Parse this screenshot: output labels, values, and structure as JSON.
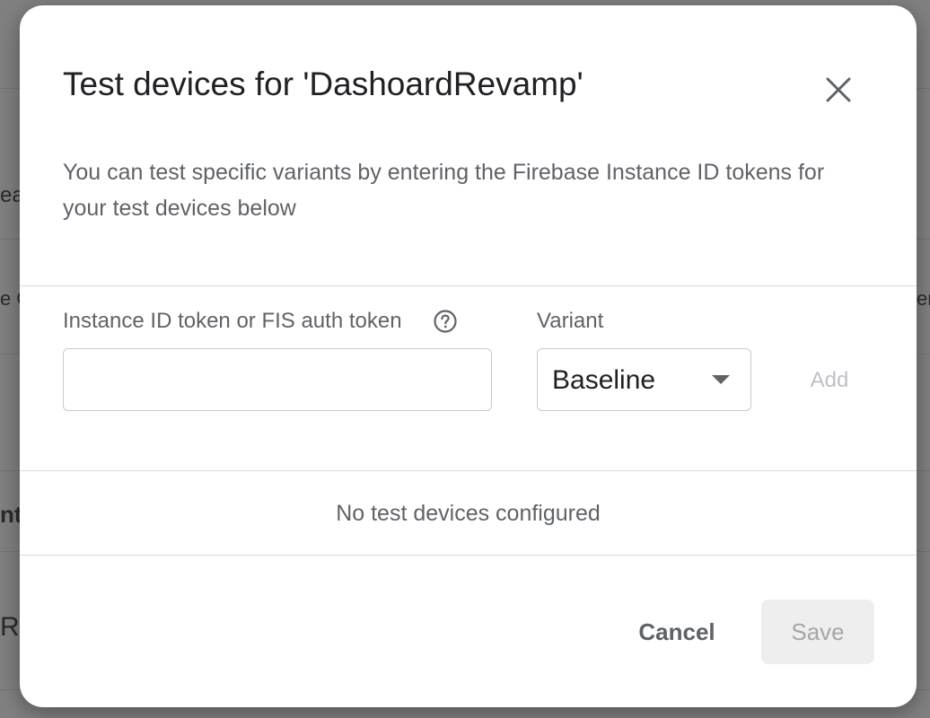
{
  "background": {
    "fragments": [
      "ea",
      "e O",
      "nti",
      "Ra",
      "er"
    ]
  },
  "dialog": {
    "title": "Test devices for 'DashoardRevamp'",
    "close_icon": "close-icon",
    "description": "You can test specific variants by entering the Firebase Instance ID tokens for your test devices below",
    "token_field": {
      "label": "Instance ID token or FIS auth token",
      "value": "",
      "help_icon": "help-circle-icon"
    },
    "variant_field": {
      "label": "Variant",
      "selected": "Baseline"
    },
    "add_label": "Add",
    "empty_state": "No test devices configured",
    "cancel_label": "Cancel",
    "save_label": "Save"
  },
  "colors": {
    "title": "#202124",
    "secondary_text": "#5f6368",
    "disabled_text": "#bdc1c6",
    "divider": "#dadce0",
    "save_disabled_bg": "#eeeeee"
  }
}
